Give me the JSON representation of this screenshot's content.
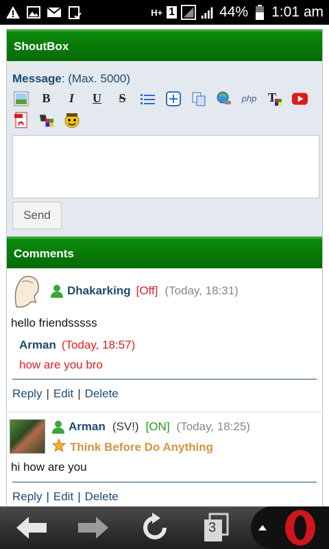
{
  "status_bar": {
    "network": "H+",
    "sim": "1",
    "battery": "44%",
    "time": "1:01 am"
  },
  "shoutbox": {
    "title": "ShoutBox",
    "message_label": "Message",
    "message_max": ": (Max. 5000)",
    "toolbar_icons": [
      "image-icon",
      "bold-icon",
      "italic-icon",
      "underline-icon",
      "strike-icon",
      "list-icon",
      "plus-box-icon",
      "copy-icon",
      "link-icon",
      "php-icon",
      "text-color-icon",
      "youtube-icon",
      "pdf-icon",
      "palette-icon",
      "smiley-icon"
    ],
    "send_label": "Send"
  },
  "comments": {
    "title": "Comments",
    "items": [
      {
        "username": "Dhakarking",
        "state": "[Off]",
        "time": "(Today,  18:31)",
        "text": "hello friendsssss",
        "reply": {
          "username": "Arman",
          "time": "(Today,  18:57)",
          "text": "how are you bro"
        },
        "actions": [
          "Reply",
          "Edit",
          "Delete"
        ]
      },
      {
        "username": "Arman",
        "tag": "(SV!)",
        "state": "[ON]",
        "time": "(Today,  18:25)",
        "rank": "Think Before Do Anything",
        "text": "hi how are you",
        "actions": [
          "Reply",
          "Edit",
          "Delete"
        ]
      }
    ]
  },
  "nav_bar": {
    "tab_count": "3"
  }
}
